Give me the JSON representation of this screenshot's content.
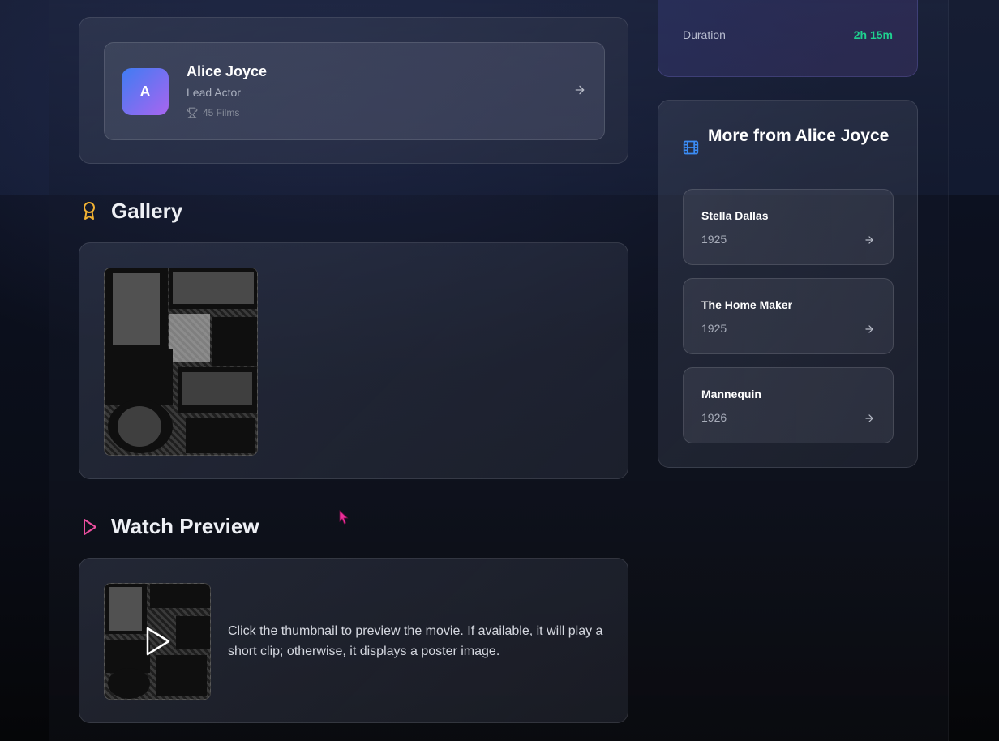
{
  "actor": {
    "initial": "A",
    "name": "Alice Joyce",
    "role": "Lead Actor",
    "films": "45 Films",
    "icons": {
      "films": "trophy-icon",
      "open": "arrow-right-icon"
    }
  },
  "gallery": {
    "title": "Gallery",
    "icon": "award-icon",
    "icon_color": "#f2b233"
  },
  "preview": {
    "title": "Watch Preview",
    "icon": "play-icon",
    "icon_color": "#ec4fa0",
    "description": "Click the thumbnail to preview the movie. If available, it will play a short clip; otherwise, it displays a poster image."
  },
  "info": {
    "duration_label": "Duration",
    "duration_value": "2h 15m",
    "accent": "#1fd08f"
  },
  "more": {
    "title": "More from Alice Joyce",
    "icon": "film-icon",
    "icon_color": "#3b8cf5",
    "movies": [
      {
        "title": "Stella Dallas",
        "year": "1925"
      },
      {
        "title": "The Home Maker",
        "year": "1925"
      },
      {
        "title": "Mannequin",
        "year": "1926"
      }
    ]
  }
}
